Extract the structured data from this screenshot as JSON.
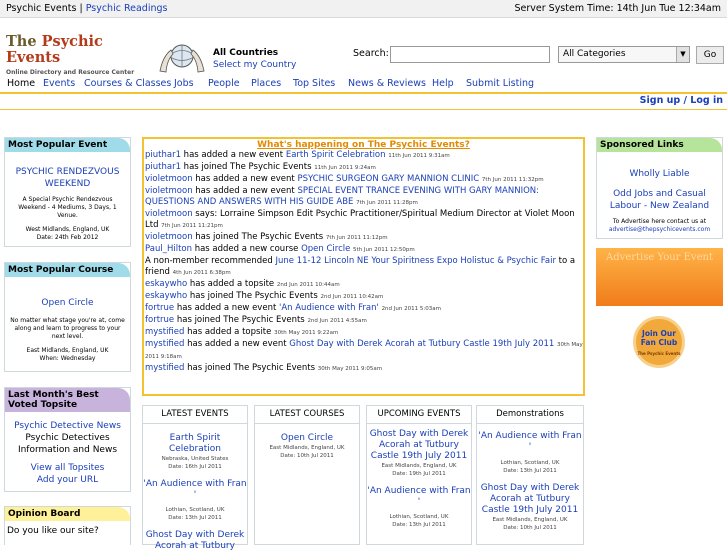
{
  "topbar": {
    "link1": "Psychic Events",
    "link2": "Psychic Readings",
    "server_time": "Server System Time: 14th Jun Tue 12:34am"
  },
  "logo": {
    "title_the": "The",
    "title_rest": "Psychic Events",
    "subtitle": "Online Directory and Resource Center"
  },
  "country": {
    "label": "All Countries",
    "link": "Select my Country"
  },
  "search": {
    "label": "Search:",
    "value": "",
    "category": "All Categories",
    "go": "Go"
  },
  "nav": [
    "Home",
    "Events",
    "Courses & Classes",
    "Jobs",
    "People",
    "Places",
    "Top Sites",
    "News & Reviews",
    "Help",
    "Submit Listing"
  ],
  "signup": "Sign up / Log in",
  "popular_event": {
    "heading": "Most Popular Event",
    "title": "PSYCHIC RENDEZVOUS WEEKEND",
    "desc": "A Special Psychic Rendezvous Weekend - 4 Mediums, 3 Days, 1 Venue.",
    "location": "West Midlands, England, UK",
    "date": "Date: 24th Feb 2012"
  },
  "popular_course": {
    "heading": "Most Popular Course",
    "title": "Open Circle",
    "desc": "No matter what stage you're at, come along and learn to progress to your next level.",
    "location": "East Midlands, England, UK",
    "date": "When: Wednesday"
  },
  "best_topsite": {
    "heading": "Last Month's Best Voted Topsite",
    "title": "Psychic Detective News",
    "desc": "Psychic Detectives Information and News",
    "view_all": "View all Topsites",
    "add": "Add your URL"
  },
  "opinion": {
    "heading": "Opinion Board",
    "question": "Do you like our site?"
  },
  "feed": {
    "title": "What's happening on The Psychic Events?",
    "items": [
      {
        "user": "piuthar1",
        "text": " has added a new event ",
        "link": "Earth Spirit Celebration",
        "date": "11th Jun 2011 9:31am"
      },
      {
        "user": "piuthar1",
        "text": " has joined The Psychic Events ",
        "link": "",
        "date": "11th Jun 2011 9:24am"
      },
      {
        "user": "violetmoon",
        "text": " has added a new event ",
        "link": "PSYCHIC SURGEON GARY MANNION CLINIC",
        "date": "7th Jun 2011 11:32pm"
      },
      {
        "user": "violetmoon",
        "text": " has added a new event ",
        "link": "SPECIAL EVENT TRANCE EVENING WITH GARY MANNION: QUESTIONS AND ANSWERS WITH HIS GUIDE ABE",
        "date": "7th Jun 2011 11:28pm"
      },
      {
        "user": "violetmoon",
        "text": " says: Lorraine Simpson Edit Psychic Practitioner/Spiritual Medium Director at Violet Moon Ltd ",
        "link": "",
        "date": "7th Jun 2011 11:21pm"
      },
      {
        "user": "violetmoon",
        "text": " has joined The Psychic Events ",
        "link": "",
        "date": "7th Jun 2011 11:12pm"
      },
      {
        "user": "Paul_Hilton",
        "text": " has added a new course ",
        "link": "Open Circle",
        "date": "5th Jun 2011 12:50pm"
      },
      {
        "user": "",
        "text": "A non-member recommended ",
        "link": "June 11-12 Lincoln NE Your Spiritness Expo Holistuc & Psychic Fair",
        "text2": " to a friend ",
        "date": "4th Jun 2011 6:38pm"
      },
      {
        "user": "eskaywho",
        "text": " has added a topsite ",
        "link": "",
        "date": "2nd Jun 2011 10:44am"
      },
      {
        "user": "eskaywho",
        "text": " has joined The Psychic Events ",
        "link": "",
        "date": "2nd Jun 2011 10:42am"
      },
      {
        "user": "fortrue",
        "text": " has added a new event ",
        "link": "'An Audience with Fran'",
        "date": "2nd Jun 2011 5:03am"
      },
      {
        "user": "fortrue",
        "text": " has joined The Psychic Events ",
        "link": "",
        "date": "2nd Jun 2011 4:55am"
      },
      {
        "user": "mystified",
        "text": " has added a topsite ",
        "link": "",
        "date": "30th May 2011 9:22am"
      },
      {
        "user": "mystified",
        "text": " has added a new event ",
        "link": "Ghost Day with Derek Acorah at Tutbury Castle 19th July 2011",
        "date": "30th May 2011 9:18am"
      },
      {
        "user": "mystified",
        "text": " has joined The Psychic Events ",
        "link": "",
        "date": "30th May 2011 9:05am"
      }
    ]
  },
  "columns": {
    "latest_events": {
      "heading": "LATEST EVENTS",
      "e1": "Earth Spirit Celebration",
      "m1a": "Nebraska, United States",
      "m1b": "Date: 16th Jul 2011",
      "e2": "'An Audience with Fran '",
      "m2a": "Lothian, Scotland, UK",
      "m2b": "Date: 13th Jul 2011",
      "e3": "Ghost Day with Derek Acorah at Tutbury"
    },
    "latest_courses": {
      "heading": "LATEST COURSES",
      "e1": "Open Circle",
      "m1a": "East Midlands, England, UK",
      "m1b": "Date: 10th Jul 2011"
    },
    "upcoming_events": {
      "heading": "UPCOMING EVENTS",
      "e1": "Ghost Day with Derek Acorah at Tutbury Castle 19th July 2011",
      "m1a": "East Midlands, England, UK",
      "m1b": "Date: 19th Jul 2011",
      "e2": "'An Audience with Fran '",
      "m2a": "Lothian, Scotland, UK",
      "m2b": "Date: 13th Jul 2011"
    },
    "demonstrations": {
      "heading": "Demonstrations",
      "e1": "'An Audience with Fran '",
      "m1a": "Lothian, Scotland, UK",
      "m1b": "Date: 13th Jul 2011",
      "e2": "Ghost Day with Derek Acorah at Tutbury Castle 19th July 2011",
      "m2a": "East Midlands, England, UK",
      "m2b": "Date: 10th Jul 2011"
    }
  },
  "sponsored": {
    "heading": "Sponsored Links",
    "l1": "Wholly Liable",
    "l2": "Odd Jobs and Casual Labour - New Zealand",
    "note": "To Advertise here contact us at",
    "email": "advertise@thepsychicevents.com"
  },
  "advertise": {
    "text": "Advertise Your Event"
  },
  "fanclub": {
    "text": "Join Our Fan Club",
    "sub": "The Psychic Events"
  },
  "colors": {
    "accent_yellow": "#f1c232",
    "link_blue": "#1a3fb8",
    "feed_title": "#e38a00"
  }
}
